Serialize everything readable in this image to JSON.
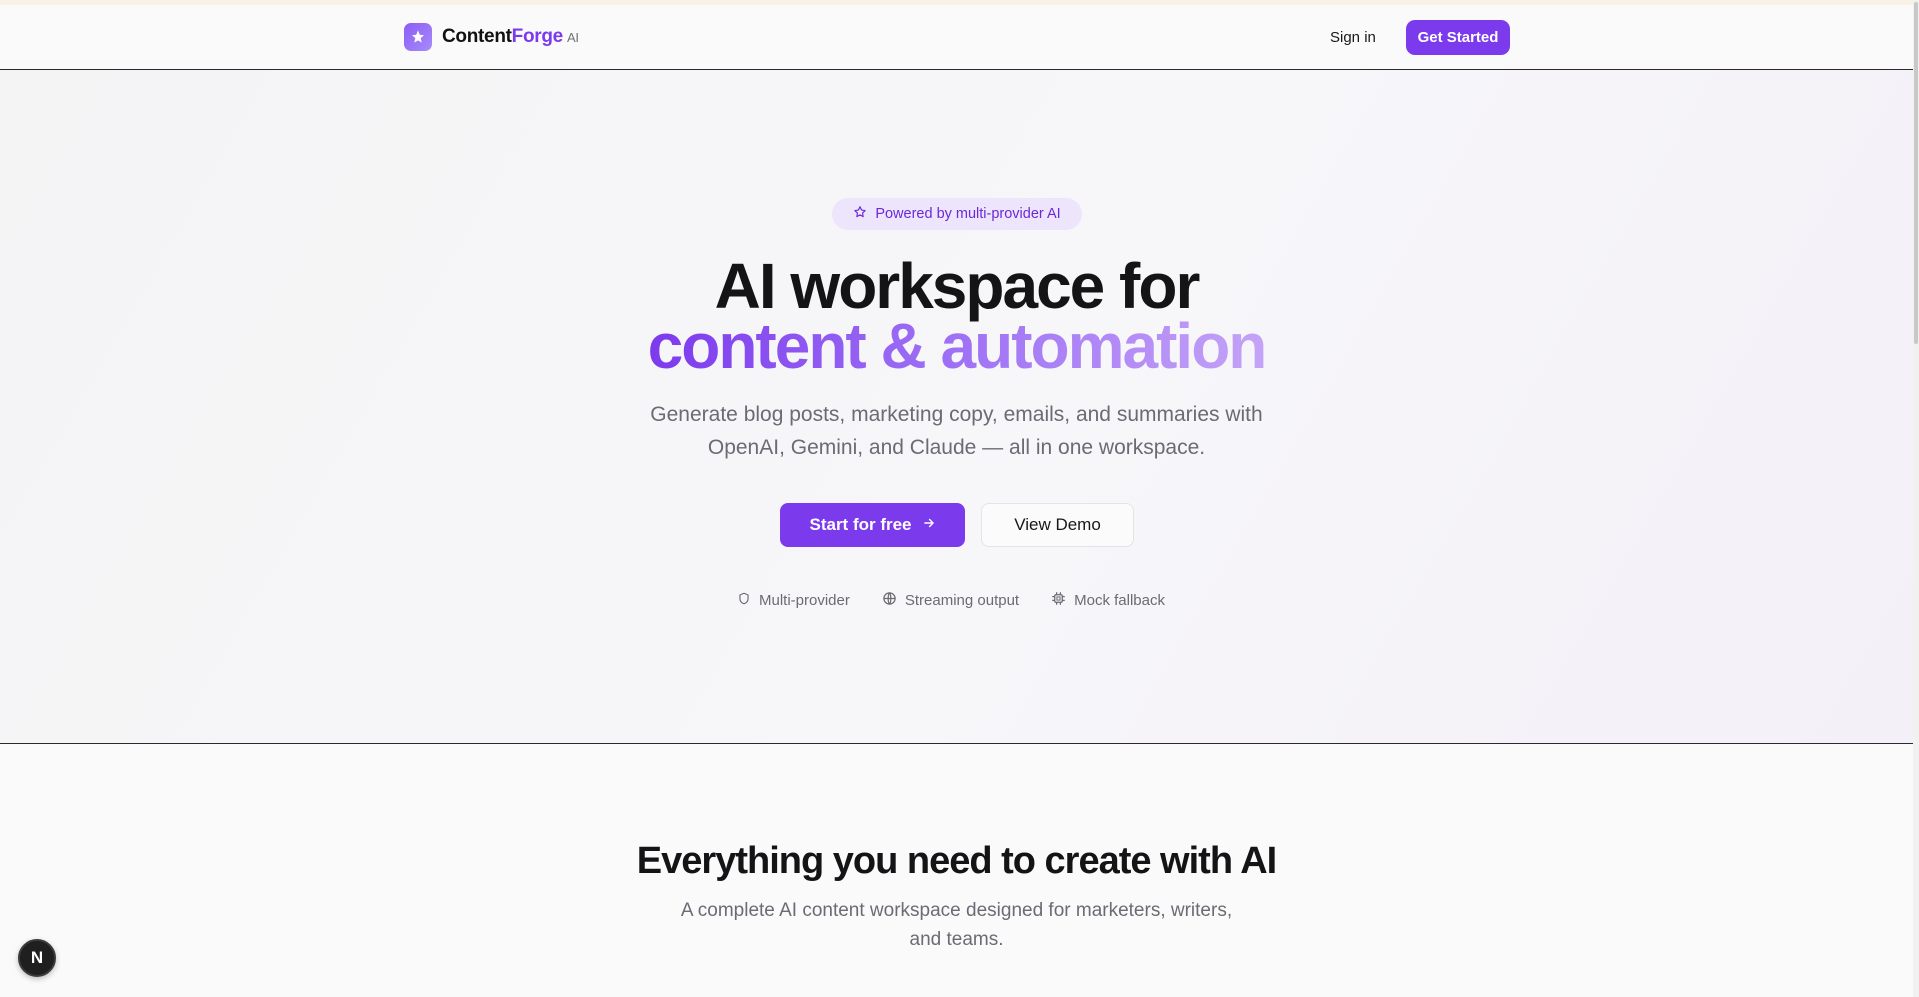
{
  "header": {
    "brand_prefix": "Content",
    "brand_accent": "Forge",
    "brand_suffix": "AI",
    "logo_icon": "sparkle-icon",
    "signin_label": "Sign in",
    "get_started_label": "Get Started"
  },
  "hero": {
    "badge_icon": "star-icon",
    "badge_text": "Powered by multi-provider AI",
    "headline_line1": "AI workspace for",
    "headline_line2": "content & automation",
    "subtitle_line1": "Generate blog posts, marketing copy, emails, and summaries with",
    "subtitle_line2": "OpenAI, Gemini, and Claude — all in one workspace.",
    "primary_cta": "Start for free",
    "primary_cta_icon": "arrow-right-icon",
    "secondary_cta": "View Demo",
    "features": [
      {
        "icon": "shield-icon",
        "label": "Multi-provider"
      },
      {
        "icon": "globe-icon",
        "label": "Streaming output"
      },
      {
        "icon": "chip-icon",
        "label": "Mock fallback"
      }
    ]
  },
  "section_features": {
    "title": "Everything you need to create with AI",
    "subtitle_line1": "A complete AI content workspace designed for marketers, writers,",
    "subtitle_line2": "and teams."
  },
  "devtools": {
    "badge_letter": "N"
  },
  "colors": {
    "accent": "#7c3aed",
    "accent_light": "#c4a3f7",
    "text": "#18181b",
    "muted": "#6b6b74"
  }
}
